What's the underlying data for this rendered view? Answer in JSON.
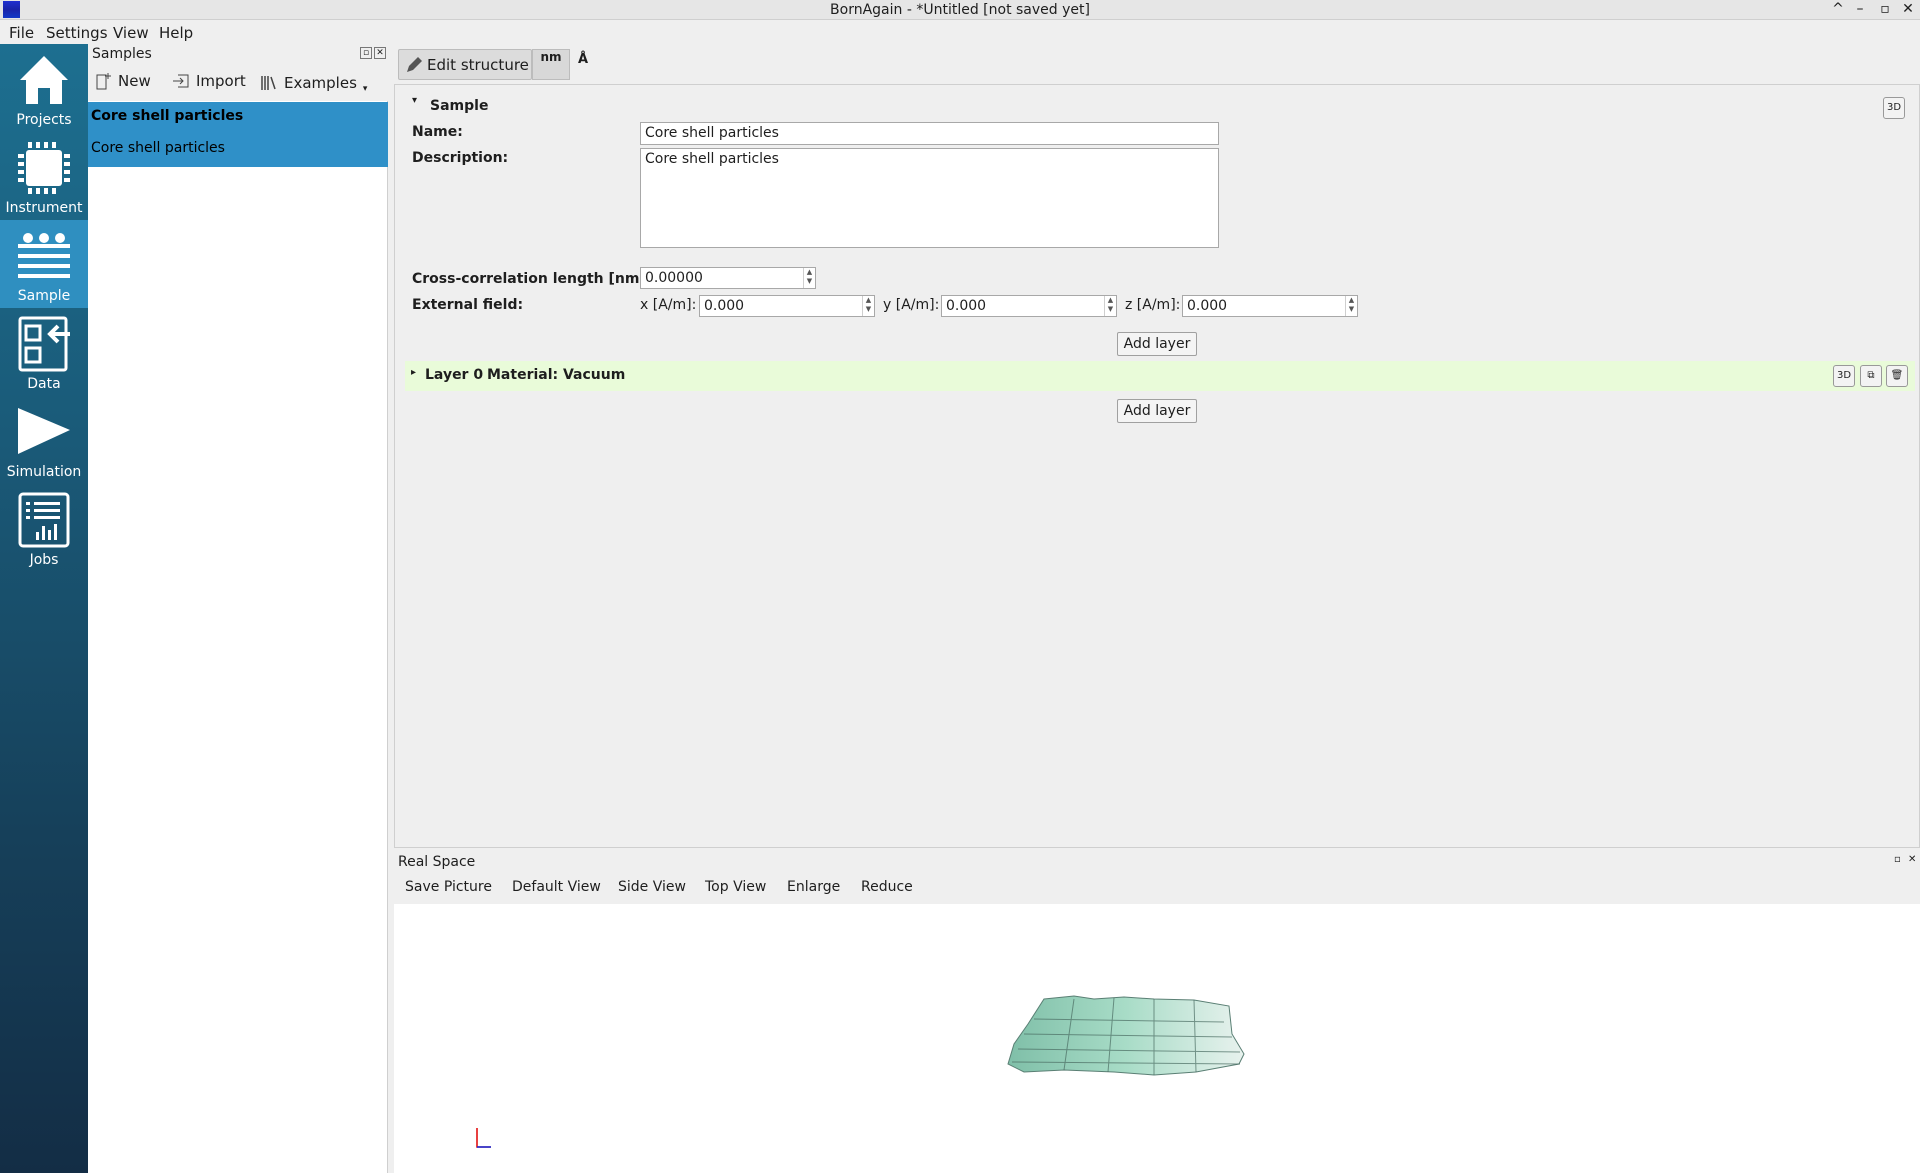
{
  "window": {
    "title": "BornAgain - *Untitled [not saved yet]"
  },
  "menu": [
    "File",
    "Settings",
    "View",
    "Help"
  ],
  "nav": [
    {
      "label": "Projects",
      "icon": "home-icon"
    },
    {
      "label": "Instrument",
      "icon": "chip-icon"
    },
    {
      "label": "Sample",
      "icon": "layers-icon",
      "active": true
    },
    {
      "label": "Data",
      "icon": "data-import-icon"
    },
    {
      "label": "Simulation",
      "icon": "play-icon"
    },
    {
      "label": "Jobs",
      "icon": "jobs-chart-icon"
    }
  ],
  "samples": {
    "title": "Samples",
    "toolbar": {
      "new": "New",
      "import": "Import",
      "examples": "Examples"
    },
    "selected_name": "Core shell particles",
    "selected_desc": "Core shell particles"
  },
  "editor": {
    "tabs": {
      "edit": "Edit structure",
      "unit": "nm",
      "angle": "Å"
    },
    "section": "Sample",
    "name_label": "Name:",
    "name_value": "Core shell particles",
    "desc_label": "Description:",
    "desc_value": "Core shell particles",
    "cc_label": "Cross-correlation length [nm]:",
    "cc_value": "0.00000",
    "ext_label": "External field:",
    "x_label": "x [A/m]:",
    "x_value": "0.000",
    "y_label": "y [A/m]:",
    "y_value": "0.000",
    "z_label": "z [A/m]:",
    "z_value": "0.000",
    "add_layer": "Add layer",
    "layer_title": "Layer 0",
    "layer_material": "Material: Vacuum"
  },
  "realspace": {
    "title": "Real Space",
    "toolbar": [
      "Save Picture",
      "Default View",
      "Side View",
      "Top View",
      "Enlarge",
      "Reduce"
    ]
  }
}
